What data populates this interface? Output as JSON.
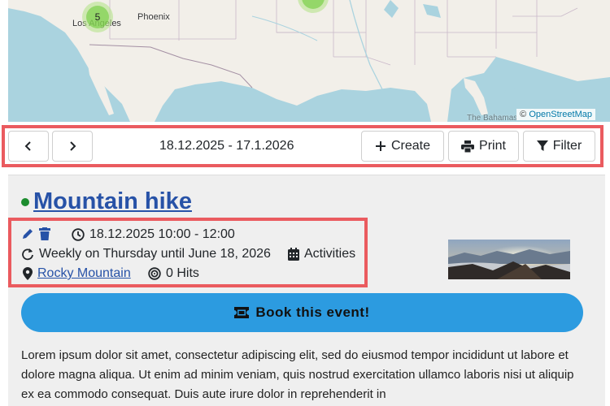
{
  "map": {
    "cities": [
      "Phoenix",
      "Los Angeles",
      "The Bahamas"
    ],
    "cluster_count": "5",
    "attribution_symbol": "©",
    "attribution_text": "OpenStreetMap"
  },
  "toolbar": {
    "date_range": "18.12.2025 - 17.1.2026",
    "create_label": "Create",
    "print_label": "Print",
    "filter_label": "Filter"
  },
  "event": {
    "title": "Mountain hike",
    "status_color": "#1c8c2e",
    "datetime": "18.12.2025 10:00 - 12:00",
    "recurrence": "Weekly on Thursday until June 18, 2026",
    "category": "Activities",
    "location": "Rocky Mountain",
    "hits": "0 Hits",
    "book_label": "Book this event!",
    "description": "Lorem ipsum dolor sit amet, consectetur adipiscing elit, sed do eiusmod tempor incididunt ut labore et dolore magna aliqua. Ut enim ad minim veniam, quis nostrud exercitation ullamco laboris nisi ut aliquip ex ea commodo consequat. Duis aute irure dolor in reprehenderit in"
  },
  "colors": {
    "accent_blue": "#2752a7",
    "book_button": "#2c9be0",
    "highlight_border": "#ea5b5f"
  }
}
